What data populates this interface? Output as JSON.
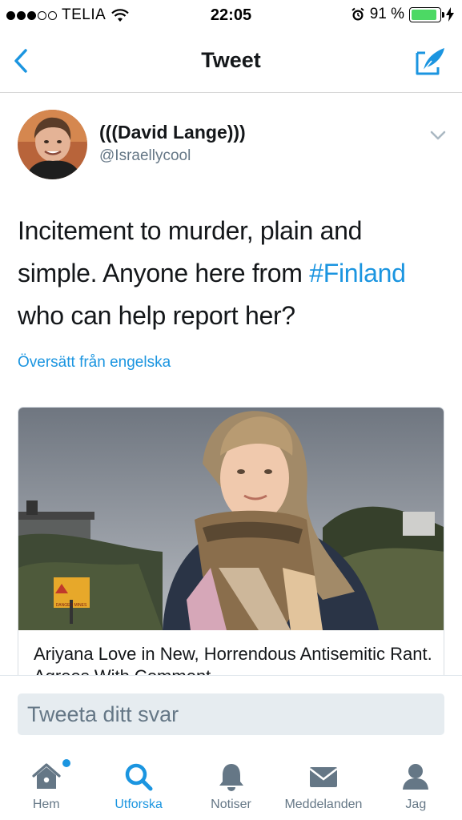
{
  "status_bar": {
    "carrier": "TELIA",
    "time": "22:05",
    "battery_percent": "91 %",
    "battery_level": 0.91,
    "signal_bars_filled": 3,
    "signal_bars_total": 5
  },
  "nav": {
    "title": "Tweet",
    "back_icon": "chevron-left-icon",
    "compose_icon": "compose-tweet-icon"
  },
  "tweet": {
    "display_name": "(((David Lange)))",
    "handle": "@Israellycool",
    "text_before": "Incitement to murder, plain and simple. Anyone here from ",
    "hashtag": "#Finland",
    "text_after": " who can help report her?",
    "translate_label": "Översätt från engelska"
  },
  "card": {
    "title": "Ariyana Love in New, Horrendous Antisemitic Rant. Agrees With Comment",
    "sign_text": "DANGER MINES"
  },
  "reply": {
    "placeholder": "Tweeta ditt svar"
  },
  "tabs": [
    {
      "label": "Hem",
      "icon": "home-icon",
      "active": false,
      "has_badge": true
    },
    {
      "label": "Utforska",
      "icon": "search-icon",
      "active": true,
      "has_badge": false
    },
    {
      "label": "Notiser",
      "icon": "bell-icon",
      "active": false,
      "has_badge": false
    },
    {
      "label": "Meddelanden",
      "icon": "envelope-icon",
      "active": false,
      "has_badge": false
    },
    {
      "label": "Jag",
      "icon": "person-icon",
      "active": false,
      "has_badge": false
    }
  ],
  "colors": {
    "accent": "#1b95e0",
    "text_primary": "#14171a",
    "text_secondary": "#657786",
    "battery": "#4cd964"
  }
}
